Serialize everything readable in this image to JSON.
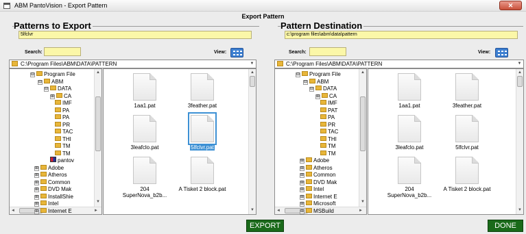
{
  "window": {
    "title": "ABM PantoVision - Export Pattern",
    "close_label": "✕"
  },
  "header": {
    "title": "Export Pattern"
  },
  "left": {
    "group_title": "Patterns to Export",
    "path_value": "5lfclvr",
    "search_label": "Search:",
    "search_value": "",
    "view_label": "View:",
    "combo_value": "C:\\Program Files\\ABM\\DATA\\PATTERN",
    "tree": [
      {
        "label": "Program File",
        "expander": "⊟",
        "icon": "folder"
      },
      {
        "label": "ABM",
        "expander": "⊟",
        "icon": "folder"
      },
      {
        "label": "DATA",
        "expander": "⊟",
        "icon": "folder"
      },
      {
        "label": "CA",
        "expander": "⊞",
        "icon": "folder"
      },
      {
        "label": "IMF",
        "expander": "",
        "icon": "folder"
      },
      {
        "label": "PA",
        "expander": "",
        "icon": "folder"
      },
      {
        "label": "PA",
        "expander": "",
        "icon": "folder"
      },
      {
        "label": "PR",
        "expander": "",
        "icon": "folder"
      },
      {
        "label": "TAC",
        "expander": "",
        "icon": "folder"
      },
      {
        "label": "THI",
        "expander": "",
        "icon": "folder"
      },
      {
        "label": "TM",
        "expander": "",
        "icon": "folder"
      },
      {
        "label": "TM",
        "expander": "",
        "icon": "folder"
      },
      {
        "label": "pantov",
        "expander": "",
        "icon": "program"
      },
      {
        "label": "Adobe",
        "expander": "⊞",
        "icon": "folder"
      },
      {
        "label": "Atheros",
        "expander": "⊞",
        "icon": "folder"
      },
      {
        "label": "Common",
        "expander": "⊞",
        "icon": "folder"
      },
      {
        "label": "DVD Mak",
        "expander": "⊞",
        "icon": "folder"
      },
      {
        "label": "InstallShie",
        "expander": "⊞",
        "icon": "folder"
      },
      {
        "label": "Intel",
        "expander": "⊞",
        "icon": "folder"
      },
      {
        "label": "Internet E",
        "expander": "⊞",
        "icon": "folder"
      }
    ],
    "files": [
      {
        "name": "1aa1.pat",
        "selected": false
      },
      {
        "name": "3feather.pat",
        "selected": false
      },
      {
        "name": "3leafclo.pat",
        "selected": false
      },
      {
        "name": "5lfclvr.pat",
        "selected": true
      },
      {
        "name": "204 SuperNova_b2b...",
        "selected": false
      },
      {
        "name": "A Tisket 2 block.pat",
        "selected": false
      }
    ]
  },
  "right": {
    "group_title": "Pattern Destination",
    "path_value": "c:\\program files\\abm\\data\\pattern",
    "search_label": "Search:",
    "search_value": "",
    "view_label": "View:",
    "combo_value": "C:\\Program Files\\ABM\\DATA\\PATTERN",
    "tree": [
      {
        "label": "Program File",
        "expander": "⊟",
        "icon": "folder"
      },
      {
        "label": "ABM",
        "expander": "⊟",
        "icon": "folder"
      },
      {
        "label": "DATA",
        "expander": "⊟",
        "icon": "folder"
      },
      {
        "label": "CA",
        "expander": "⊞",
        "icon": "folder"
      },
      {
        "label": "IMF",
        "expander": "",
        "icon": "folder"
      },
      {
        "label": "PAT",
        "expander": "",
        "icon": "folder"
      },
      {
        "label": "PA",
        "expander": "",
        "icon": "folder"
      },
      {
        "label": "PR",
        "expander": "",
        "icon": "folder"
      },
      {
        "label": "TAC",
        "expander": "",
        "icon": "folder"
      },
      {
        "label": "THI",
        "expander": "",
        "icon": "folder"
      },
      {
        "label": "TM",
        "expander": "",
        "icon": "folder"
      },
      {
        "label": "TM",
        "expander": "",
        "icon": "folder"
      },
      {
        "label": "Adobe",
        "expander": "⊞",
        "icon": "folder"
      },
      {
        "label": "Atheros",
        "expander": "⊞",
        "icon": "folder"
      },
      {
        "label": "Common",
        "expander": "⊞",
        "icon": "folder"
      },
      {
        "label": "DVD Mak",
        "expander": "⊞",
        "icon": "folder"
      },
      {
        "label": "Intel",
        "expander": "⊞",
        "icon": "folder"
      },
      {
        "label": "Internet E",
        "expander": "⊞",
        "icon": "folder"
      },
      {
        "label": "Microsoft",
        "expander": "⊞",
        "icon": "folder"
      },
      {
        "label": "MSBuild",
        "expander": "⊞",
        "icon": "folder"
      }
    ],
    "files": [
      {
        "name": "1aa1.pat",
        "selected": false
      },
      {
        "name": "3feather.pat",
        "selected": false
      },
      {
        "name": "3leafclo.pat",
        "selected": false
      },
      {
        "name": "5lfclvr.pat",
        "selected": false
      },
      {
        "name": "204 SuperNova_b2b...",
        "selected": false
      },
      {
        "name": "A Tisket 2 block.pat",
        "selected": false
      }
    ]
  },
  "buttons": {
    "export_label": "EXPORT",
    "done_label": "DONE"
  },
  "colors": {
    "field_bg": "#fbf7a8",
    "button_bg": "#1a6a1a",
    "selection": "#3c90d4"
  }
}
